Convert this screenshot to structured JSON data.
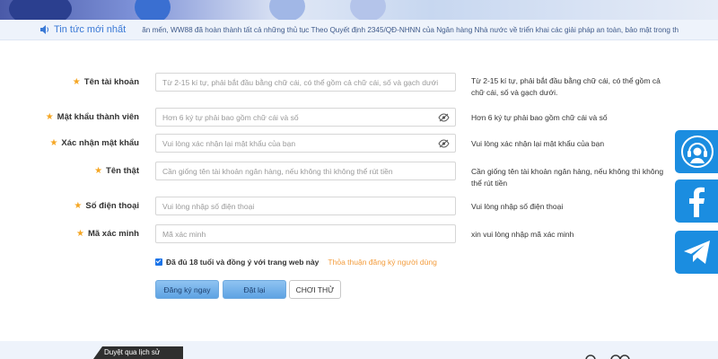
{
  "news": {
    "label": "Tin tức mới nhất",
    "text": "ăn mến, WW88 đã hoàn thành tất cả những thủ tục Theo Quyết định 2345/QĐ-NHNN của Ngân hàng Nhà nước về triển khai các giải pháp an toàn, bảo mật trong th"
  },
  "form": {
    "rows": [
      {
        "label": "Tên tài khoản",
        "placeholder": "Từ 2-15 kí tự, phải bắt đầu bằng chữ cái, có thể  gồm cả chữ cái, số và gạch dưới",
        "hint": "Từ 2-15 kí tự, phải bắt đầu bằng chữ cái, có thể gồm cả chữ cái, số và gạch dưới."
      },
      {
        "label": "Mật khẩu thành viên",
        "placeholder": "Hơn 6 ký tự phải bao gồm chữ cái và số",
        "hint": "Hơn 6 ký tự phải bao gồm chữ cái và số"
      },
      {
        "label": "Xác nhận mật khẩu",
        "placeholder": "Vui lòng xác nhận lại mật khẩu của bạn",
        "hint": "Vui lòng xác nhận lại mật khẩu của bạn"
      },
      {
        "label": "Tên thật",
        "placeholder": "Cần giống tên tài khoản ngân hàng, nếu không thì không thể rút tiền",
        "hint": "Cần giống tên tài khoản ngân hàng, nếu không thì không thể rút tiền"
      },
      {
        "label": "Số điện thoại",
        "placeholder": "Vui lòng nhập số điện thoại",
        "hint": "Vui lòng nhập số điện thoại"
      },
      {
        "label": "Mã xác minh",
        "placeholder": "Mã xác minh",
        "hint": "xin vui lòng nhập mã xác minh"
      }
    ],
    "agree_text": "Đã đủ 18 tuổi và đồng ý với trang web này",
    "agree_link": "Thỏa thuận đăng ký người dùng",
    "register_label": "Đăng ký ngay",
    "reset_label": "Đặt lại",
    "try_label": "CHƠI THỬ"
  },
  "footer": {
    "history_label": "Duyệt qua lịch sử"
  },
  "colors": {
    "accent": "#1b8de0",
    "star": "#f5a623",
    "link": "#f39c3c"
  }
}
